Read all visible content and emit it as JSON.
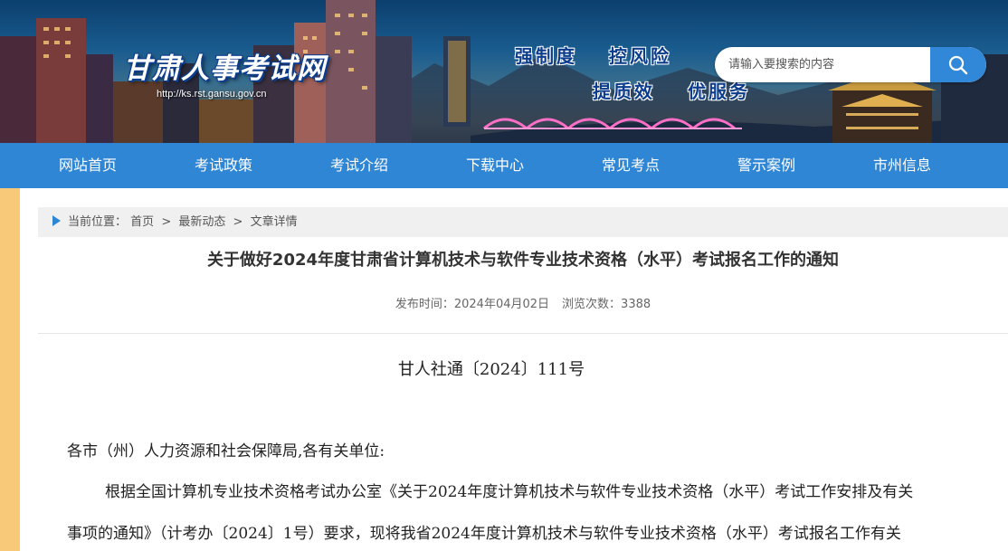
{
  "header": {
    "site_title": "甘肃人事考试网",
    "site_url": "http://ks.rst.gansu.gov.cn",
    "slogans": [
      "强制度",
      "控风险",
      "提质效",
      "优服务"
    ],
    "search": {
      "placeholder": "请输入要搜索的内容",
      "icon": "search-icon"
    }
  },
  "nav": {
    "items": [
      "网站首页",
      "考试政策",
      "考试介绍",
      "下载中心",
      "常见考点",
      "警示案例",
      "市州信息"
    ]
  },
  "breadcrumb": {
    "prefix": "当前位置：",
    "items": [
      "首页",
      "最新动态",
      "文章详情"
    ],
    "separator": ">"
  },
  "article": {
    "title": "关于做好2024年度甘肃省计算机技术与软件专业技术资格（水平）考试报名工作的通知",
    "publish_label": "发布时间：",
    "publish_date": "2024年04月02日",
    "views_label": "浏览次数：",
    "views": "3388",
    "doc_number": "甘人社通〔2024〕111号",
    "paragraphs": [
      "各市（州）人力资源和社会保障局,各有关单位:",
      "根据全国计算机专业技术资格考试办公室《关于2024年度计算机技术与软件专业技术资格（水平）考试工作安排及有关",
      "事项的通知》（计考办〔2024〕1号）要求，现将我省2024年度计算机技术与软件专业技术资格（水平）考试报名工作有关"
    ]
  },
  "colors": {
    "nav_bg": "#2f86d5",
    "search_button": "#3188d8",
    "side_strip": "#f9c97a",
    "breadcrumb_bg": "#f0f0f0"
  }
}
